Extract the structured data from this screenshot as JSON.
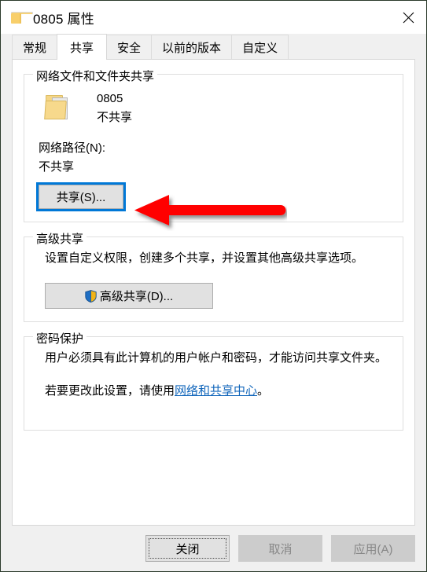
{
  "window": {
    "title": "0805 属性",
    "folder_icon": "folder-icon",
    "close_icon": "close-icon"
  },
  "tabs": [
    {
      "label": "常规",
      "active": false
    },
    {
      "label": "共享",
      "active": true
    },
    {
      "label": "安全",
      "active": false
    },
    {
      "label": "以前的版本",
      "active": false
    },
    {
      "label": "自定义",
      "active": false
    }
  ],
  "network_sharing": {
    "group_title": "网络文件和文件夹共享",
    "folder_icon": "folder-document-icon",
    "folder_name": "0805",
    "share_status": "不共享",
    "path_label": "网络路径(N):",
    "path_value": "不共享",
    "share_button": "共享(S)..."
  },
  "advanced_sharing": {
    "group_title": "高级共享",
    "description": "设置自定义权限，创建多个共享，并设置其他高级共享选项。",
    "shield_icon": "uac-shield-icon",
    "button": "高级共享(D)..."
  },
  "password_protection": {
    "group_title": "密码保护",
    "line1": "用户必须具有此计算机的用户帐户和密码，才能访问共享文件夹。",
    "line2_prefix": "若要更改此设置，请使用",
    "link": "网络和共享中心",
    "line2_suffix": "。"
  },
  "footer": {
    "close": "关闭",
    "cancel": "取消",
    "apply": "应用(A)"
  },
  "annotation": {
    "arrow_color": "#FF0000",
    "points_to": "共享(S)..."
  },
  "colors": {
    "accent_focus": "#0078D7",
    "link": "#1166BB",
    "annotation_red": "#FF0000",
    "dialog_bg": "#F0F0F0",
    "panel_bg": "#FFFFFF",
    "button_bg": "#E1E1E1",
    "disabled_bg": "#CCCCCC",
    "disabled_text": "#878787"
  }
}
